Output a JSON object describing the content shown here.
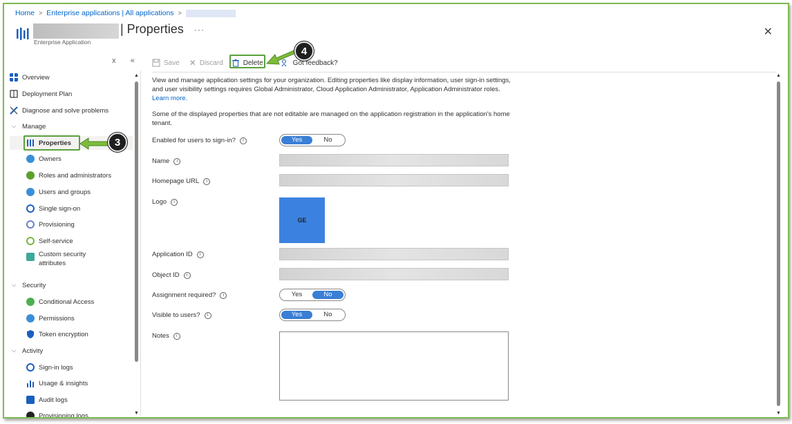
{
  "breadcrumb": {
    "home": "Home",
    "enterprise_apps": "Enterprise applications | All applications"
  },
  "header": {
    "title": "| Properties",
    "more": "···",
    "subtitle": "Enterprise Application",
    "close": "✕"
  },
  "sidebar": {
    "collapse": "«",
    "close": "x",
    "items": [
      {
        "label": "Overview"
      },
      {
        "label": "Deployment Plan"
      },
      {
        "label": "Diagnose and solve problems"
      },
      {
        "label": "Manage"
      },
      {
        "label": "Properties"
      },
      {
        "label": "Owners"
      },
      {
        "label": "Roles and administrators"
      },
      {
        "label": "Users and groups"
      },
      {
        "label": "Single sign-on"
      },
      {
        "label": "Provisioning"
      },
      {
        "label": "Self-service"
      },
      {
        "label": "Custom security"
      },
      {
        "label": "attributes"
      },
      {
        "label": "Security"
      },
      {
        "label": "Conditional Access"
      },
      {
        "label": "Permissions"
      },
      {
        "label": "Token encryption"
      },
      {
        "label": "Activity"
      },
      {
        "label": "Sign-in logs"
      },
      {
        "label": "Usage & insights"
      },
      {
        "label": "Audit logs"
      },
      {
        "label": "Provisioning logs"
      }
    ]
  },
  "toolbar": {
    "save": "Save",
    "discard": "Discard",
    "delete": "Delete",
    "feedback": "Got feedback?"
  },
  "content": {
    "intro": "View and manage application settings for your organization. Editing properties like display information, user sign-in settings, and user visibility settings requires Global Administrator, Cloud Application Administrator, Application Administrator roles.",
    "learn_more": "Learn more.",
    "note": "Some of the displayed properties that are not editable are managed on the application registration in the application's home tenant."
  },
  "fields": {
    "enabled_label": "Enabled for users to sign-in?",
    "name_label": "Name",
    "homepage_label": "Homepage URL",
    "logo_label": "Logo",
    "logo_text": "GE",
    "appid_label": "Application ID",
    "objectid_label": "Object ID",
    "assignment_label": "Assignment required?",
    "visible_label": "Visible to users?",
    "notes_label": "Notes",
    "yes": "Yes",
    "no": "No",
    "info": "i"
  },
  "toggles": {
    "enabled": "Yes",
    "assignment_required": "No",
    "visible": "Yes"
  },
  "callouts": {
    "step3": "3",
    "step4": "4"
  },
  "colors": {
    "accent": "#3a7fd5",
    "highlight_green": "#58a23a",
    "link": "#0064c8"
  }
}
